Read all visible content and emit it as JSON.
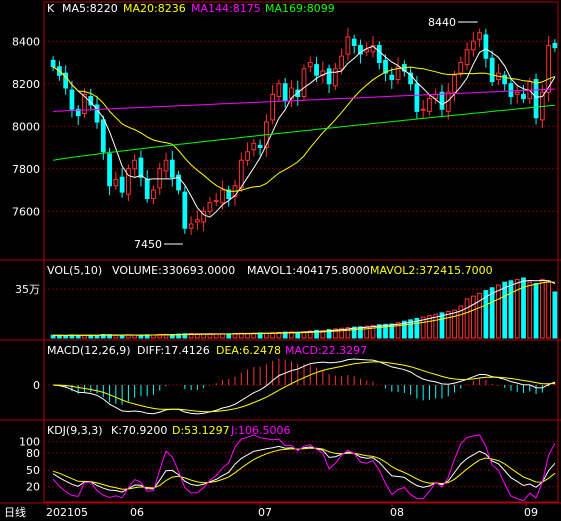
{
  "header": {
    "k_label": "K",
    "ma5": "MA5:8220",
    "ma20": "MA20:8236",
    "ma144": "MA144:8175",
    "ma169": "MA169:8099"
  },
  "vol_header": {
    "title": "VOL(5,10)",
    "volume": "VOLUME:330693.0000",
    "mavol1": "MAVOL1:404175.8000",
    "mavol2": "MAVOL2:372415.7000"
  },
  "macd_header": {
    "title": "MACD(12,26,9)",
    "diff": "DIFF:17.4126",
    "dea": "DEA:6.2478",
    "macd": "MACD:22.3297"
  },
  "kdj_header": {
    "title": "KDJ(9,3,3)",
    "k": "K:70.9200",
    "d": "D:53.1297",
    "j": "J:106.5006"
  },
  "annotations": {
    "high": "8440",
    "low": "7450"
  },
  "footer": {
    "period": "日线",
    "dates": [
      "202105",
      "06",
      "07",
      "08",
      "09"
    ]
  },
  "colors": {
    "up": "#ff3232",
    "down": "#00ffff",
    "ma5": "#ffffff",
    "ma20": "#ffff00",
    "ma144": "#ff00ff",
    "ma169": "#00ff00",
    "grid": "#7a0000",
    "axis": "#b00000"
  },
  "chart_data": {
    "type": "candlestick",
    "price": {
      "y_ticks": [
        8400,
        8200,
        8000,
        7800,
        7600
      ],
      "ylim": [
        7380,
        8500
      ],
      "closes": [
        8280,
        8240,
        8180,
        8080,
        8050,
        8150,
        8100,
        8020,
        7880,
        7720,
        7750,
        7690,
        7800,
        7840,
        7760,
        7660,
        7700,
        7800,
        7840,
        7760,
        7700,
        7520,
        7540,
        7560,
        7600,
        7640,
        7650,
        7700,
        7660,
        7720,
        7840,
        7880,
        7920,
        7900,
        8020,
        8150,
        8200,
        8120,
        8180,
        8140,
        8270,
        8300,
        8240,
        8260,
        8200,
        8270,
        8330,
        8420,
        8380,
        8340,
        8360,
        8380,
        8300,
        8250,
        8220,
        8280,
        8260,
        8200,
        8070,
        8080,
        8130,
        8150,
        8080,
        8160,
        8240,
        8300,
        8360,
        8400,
        8440,
        8320,
        8210,
        8250,
        8200,
        8140,
        8160,
        8130,
        8210,
        8040,
        8160,
        8380,
        8370
      ],
      "ma5_end": 8220,
      "ma20_end": 8236,
      "ma144_end": 8175,
      "ma169_end": 8099
    },
    "volume": {
      "y_ticks_label": "35万",
      "values": [
        20,
        18,
        17,
        22,
        19,
        21,
        20,
        18,
        25,
        24,
        20,
        19,
        22,
        21,
        20,
        23,
        22,
        25,
        26,
        24,
        28,
        30,
        32,
        30,
        28,
        27,
        29,
        31,
        30,
        32,
        34,
        33,
        35,
        36,
        34,
        38,
        40,
        42,
        44,
        40,
        45,
        50,
        55,
        52,
        60,
        65,
        70,
        75,
        78,
        80,
        85,
        90,
        95,
        98,
        100,
        110,
        120,
        130,
        140,
        150,
        160,
        170,
        180,
        190,
        200,
        230,
        280,
        300,
        320,
        340,
        360,
        380,
        400,
        410,
        420,
        430,
        400,
        390,
        420,
        410,
        330
      ],
      "mavol1_end": 404175.8,
      "mavol2_end": 372415.7,
      "unit": "万"
    },
    "macd": {
      "zero_label": "0",
      "diff_end": 17.4126,
      "dea_end": 6.2478,
      "macd_end": 22.3297
    },
    "kdj": {
      "y_ticks": [
        100,
        80,
        50,
        20
      ],
      "k_end": 70.92,
      "d_end": 53.1297,
      "j_end": 106.5006
    },
    "x_categories": [
      "202105",
      "06",
      "07",
      "08",
      "09"
    ]
  }
}
